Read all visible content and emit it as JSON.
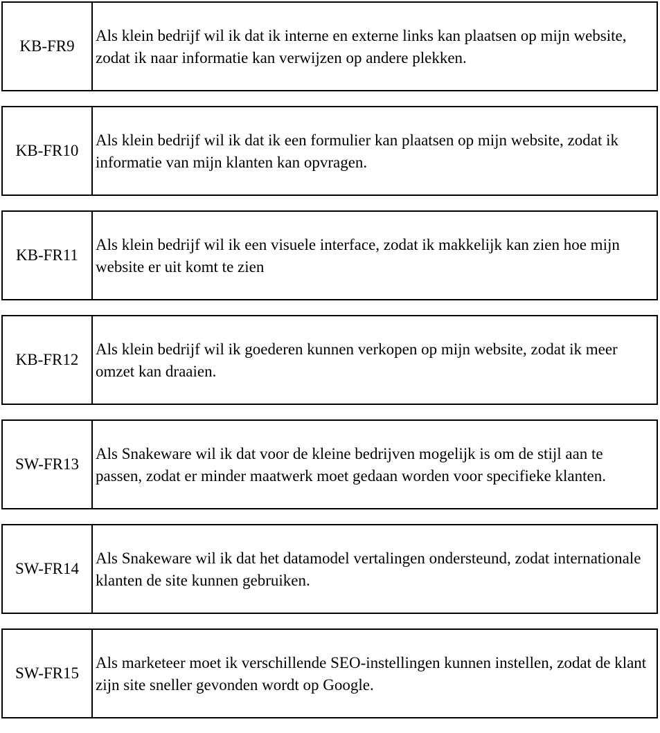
{
  "requirements": [
    {
      "id": "KB-FR9",
      "text": "Als klein bedrijf wil ik dat ik interne en externe links kan plaatsen op mijn website, zodat ik naar informatie kan verwijzen op andere plekken."
    },
    {
      "id": "KB-FR10",
      "text": "Als klein bedrijf wil ik dat ik een formulier kan plaatsen op mijn website, zodat ik informatie van mijn klanten kan opvragen."
    },
    {
      "id": "KB-FR11",
      "text": "Als klein bedrijf wil ik een visuele interface, zodat ik makkelijk kan zien hoe mijn website er uit komt te zien"
    },
    {
      "id": "KB-FR12",
      "text": "Als klein bedrijf wil ik goederen kunnen verkopen op mijn website, zodat ik meer omzet kan draaien."
    },
    {
      "id": "SW-FR13",
      "text": "Als Snakeware wil ik dat voor de kleine bedrijven mogelijk is om de stijl aan te passen, zodat er minder maatwerk moet gedaan worden voor specifieke klanten."
    },
    {
      "id": "SW-FR14",
      "text": "Als Snakeware wil ik dat het datamodel vertalingen ondersteund, zodat internationale klanten de site kunnen gebruiken."
    },
    {
      "id": "SW-FR15",
      "text": "Als marketeer moet ik verschillende SEO-instellingen kunnen instellen, zodat de klant zijn site sneller gevonden wordt op Google."
    }
  ]
}
